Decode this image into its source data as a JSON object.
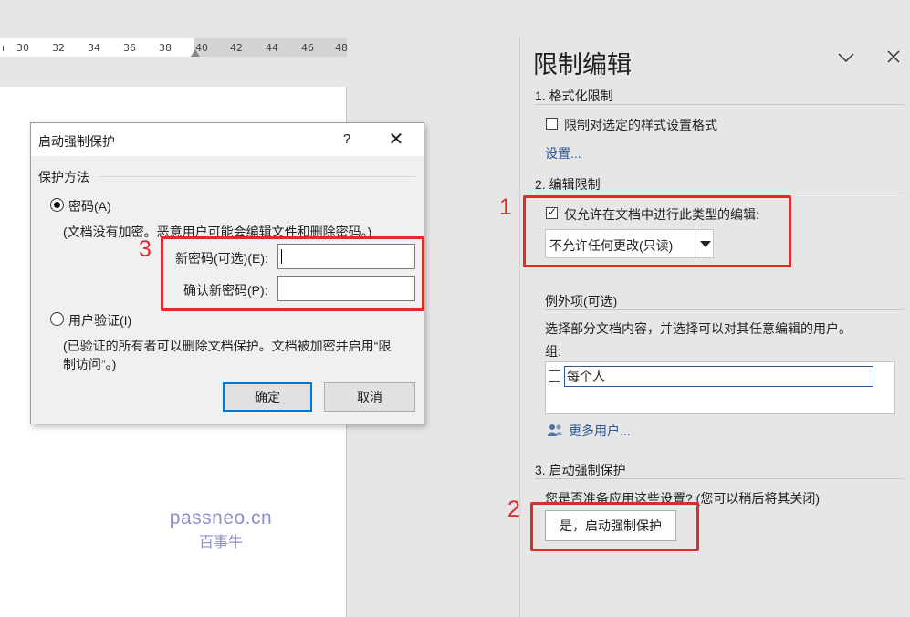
{
  "ruler": {
    "ticks": [
      "30",
      "32",
      "34",
      "36",
      "38",
      "40",
      "42",
      "44",
      "46",
      "48"
    ]
  },
  "watermark": {
    "line1": "passneo.cn",
    "line2": "百事牛"
  },
  "dialog": {
    "title": "启动强制保护",
    "help_label": "?",
    "close_label": "✕",
    "group_label": "保护方法",
    "password_option": "密码(A)",
    "password_note": "(文档没有加密。恶意用户可能会编辑文件和删除密码。)",
    "new_password_label": "新密码(可选)(E):",
    "new_password_value": "",
    "confirm_password_label": "确认新密码(P):",
    "confirm_password_value": "",
    "user_auth_option": "用户验证(I)",
    "user_auth_note_line1": "(已验证的所有者可以删除文档保护。文档被加密并启用“限",
    "user_auth_note_line2": "制访问”。)",
    "ok_label": "确定",
    "cancel_label": "取消"
  },
  "pane": {
    "title": "限制编辑",
    "collapse_icon": "chevron-down-icon",
    "close_icon": "close-icon",
    "section1": {
      "heading": "1. 格式化限制",
      "checkbox_label": "限制对选定的样式设置格式",
      "checked": false,
      "settings_link": "设置..."
    },
    "section2": {
      "heading": "2. 编辑限制",
      "checkbox_label": "仅允许在文档中进行此类型的编辑:",
      "checked": true,
      "dropdown_value": "不允许任何更改(只读)",
      "exceptions_heading": "例外项(可选)",
      "exceptions_desc": "选择部分文档内容，并选择可以对其任意编辑的用户。",
      "groups_label": "组:",
      "everyone_label": "每个人",
      "everyone_checked": false,
      "more_users_link": "更多用户..."
    },
    "section3": {
      "heading": "3. 启动强制保护",
      "question": "您是否准备应用这些设置? (您可以稍后将其关闭)",
      "enforce_button": "是，启动强制保护"
    }
  },
  "annotations": {
    "num1": "1",
    "num2": "2",
    "num3": "3",
    "color": "#e02b2b"
  }
}
